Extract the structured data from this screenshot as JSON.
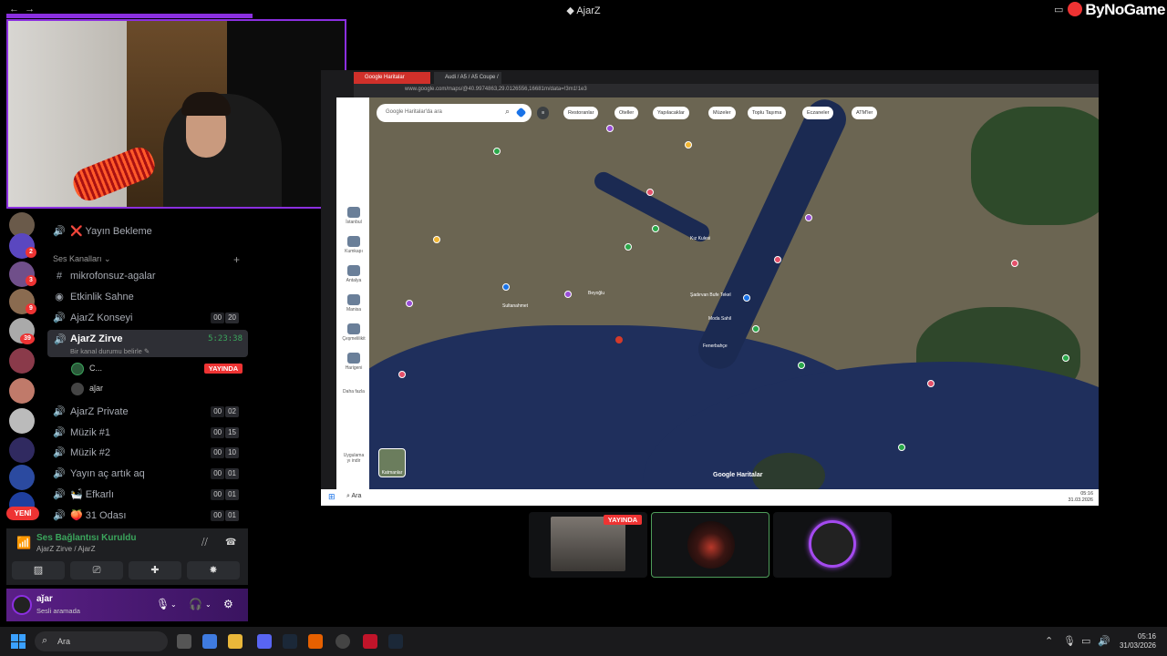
{
  "window": {
    "title": "AjarZ",
    "brand": "ByNoGame"
  },
  "sidebar": {
    "top_channel": "❌ Yayın Bekleme",
    "category": "Ses Kanalları",
    "channels": [
      {
        "icon": "#",
        "label": "mikrofonsuz-agalar"
      },
      {
        "icon": "◉",
        "label": "Etkinlik Sahne"
      },
      {
        "icon": "🔊",
        "label": "AjarZ Konseyi",
        "count_a": "00",
        "count_b": "20"
      }
    ],
    "active": {
      "label": "AjarZ Zirve",
      "time": "5:23:38",
      "sub": "Bir kanal durumu belirle ✎"
    },
    "users": [
      {
        "name": "C...",
        "badge": "YAYINDA"
      },
      {
        "name": "aǰar"
      }
    ],
    "channels2": [
      {
        "label": "AjarZ Private",
        "count_a": "00",
        "count_b": "02"
      },
      {
        "label": "Müzik #1",
        "count_a": "00",
        "count_b": "15"
      },
      {
        "label": "Müzik #2",
        "count_a": "00",
        "count_b": "10"
      },
      {
        "label": "Yayın aç artık aq",
        "count_a": "00",
        "count_b": "01"
      },
      {
        "label": "🛀 Efkarlı",
        "count_a": "00",
        "count_b": "01"
      },
      {
        "label": "🍑 31 Odası",
        "count_a": "00",
        "count_b": "01"
      }
    ],
    "rail_badges": [
      "2",
      "3",
      "9",
      "39"
    ],
    "new_label": "YENİ"
  },
  "voice": {
    "status": "Ses Bağlantısı Kuruldu",
    "channel": "AjarZ Zirve / AjarZ"
  },
  "user": {
    "name": "aǰar",
    "status": "Sesli aramada"
  },
  "shared_screen": {
    "tabs": [
      "Google Haritalar",
      "Audi / A5 / A5 Coupe / 3.0"
    ],
    "url": "www.google.com/maps/@40.9974863,29.0126556,16681m/data=!3m1!1e3",
    "search_placeholder": "Google Haritalar'da ara",
    "chips": [
      "Restoranlar",
      "Oteller",
      "Yapılacaklar",
      "Müzeler",
      "Toplu Taşıma",
      "Eczaneler",
      "ATM'ler"
    ],
    "left_items": [
      "İstanbul",
      "Kumkapı",
      "Antalya",
      "Manisa",
      "Çeşmelilikit",
      "Harigeni",
      "Daha fazla",
      "Uygulama yı indir"
    ],
    "layers_label": "Katmanlar",
    "map_brand": "Google Haritalar",
    "place_labels": [
      "Kız Kulesi",
      "Şadırvan Bufe Tekel",
      "Moda Sahil",
      "Fenerbahçe",
      "Beyoğlu",
      "Sultanahmet"
    ],
    "taskbar_search": "Ara",
    "clock_time": "05:16",
    "clock_date": "31.03.2026"
  },
  "participants": {
    "badge": "YAYINDA"
  },
  "taskbar": {
    "search": "Ara",
    "time": "05:16",
    "date": "31/03/2026"
  }
}
